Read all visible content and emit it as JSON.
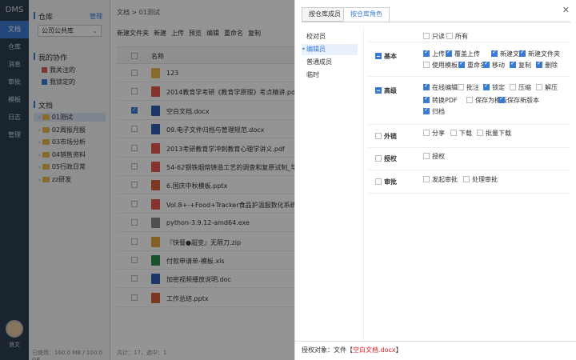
{
  "app": {
    "brand": "DMS",
    "user": "浪文"
  },
  "nav": [
    "文档",
    "仓库",
    "消息",
    "审批",
    "模板",
    "日志",
    "管理"
  ],
  "sidebar": {
    "repo_title": "仓库",
    "manage": "管理",
    "repo_select": "公司公共库",
    "collab_title": "我的协作",
    "collab": [
      "我关注的",
      "我锁定的"
    ],
    "docs_title": "文档",
    "tree": [
      "01测试",
      "02周报月报",
      "03市场分析",
      "04销售资料",
      "05行政日常",
      "zz研发"
    ],
    "footer": "已使用：160.0 MB / 100.0 GB"
  },
  "main": {
    "breadcrumb": "文档 > 01测试",
    "toolbar": [
      "新建文件夹",
      "新建",
      "上传",
      "预览",
      "编辑",
      "重命名",
      "复制"
    ],
    "col_name": "名称",
    "files": [
      {
        "name": "123",
        "type": "folder",
        "checked": false
      },
      {
        "name": "2014教育学考研《教育学原理》考点精讲.pdf",
        "type": "pdf",
        "checked": false
      },
      {
        "name": "空白文档.docx",
        "type": "doc",
        "checked": true
      },
      {
        "name": "09.电子文件归档与管理规范.docx",
        "type": "doc",
        "checked": false
      },
      {
        "name": "2013考研教育学冲刺教育心理学讲义.pdf",
        "type": "pdf",
        "checked": false
      },
      {
        "name": "54-62钢铁烟熔铸造工艺的调查和复原试制_华觉明.pdf",
        "type": "pdf",
        "checked": false
      },
      {
        "name": "6.国庆中秋模板.pptx",
        "type": "ppt",
        "checked": false
      },
      {
        "name": "Vol.8+-+Food+Tracker食品护温服数化系统.pdf",
        "type": "pdf",
        "checked": false
      },
      {
        "name": "python-3.9.12-amd64.exe",
        "type": "exe",
        "checked": false
      },
      {
        "name": "『快餐●超变』无限刀.zip",
        "type": "zip",
        "checked": false
      },
      {
        "name": "付款申请单-模板.xls",
        "type": "xls",
        "checked": false
      },
      {
        "name": "加密视频播放说明.doc",
        "type": "doc",
        "checked": false
      },
      {
        "name": "工作总结.pptx",
        "type": "ppt",
        "checked": false
      }
    ],
    "footer": "共计：17，选中：1"
  },
  "drawer": {
    "tabs": [
      "按仓库成员",
      "按仓库角色"
    ],
    "active_tab": 1,
    "roles": [
      "校对员",
      "编辑员",
      "普通成员",
      "临时"
    ],
    "active_role": 1,
    "top_opts": [
      {
        "label": "只读",
        "on": false
      },
      {
        "label": "所有",
        "on": false
      }
    ],
    "groups": [
      {
        "name": "基本",
        "ind": true,
        "opts": [
          {
            "label": "上传",
            "on": true
          },
          {
            "label": "覆盖上传",
            "on": true
          },
          {
            "label": "新建文件",
            "on": true
          },
          {
            "label": "新建文件夹",
            "on": true
          },
          {
            "label": "使用模板",
            "on": false
          },
          {
            "label": "重命名",
            "on": true
          },
          {
            "label": "移动",
            "on": true
          },
          {
            "label": "复制",
            "on": true
          },
          {
            "label": "删除",
            "on": true
          }
        ]
      },
      {
        "name": "高级",
        "ind": true,
        "opts": [
          {
            "label": "在线编辑",
            "on": true
          },
          {
            "label": "批注",
            "on": false
          },
          {
            "label": "锁定",
            "on": true
          },
          {
            "label": "压缩",
            "on": false
          },
          {
            "label": "解压",
            "on": false
          },
          {
            "label": "转换PDF",
            "on": true
          },
          {
            "label": "保存为模板",
            "on": false
          },
          {
            "label": "保存新版本",
            "on": true
          },
          {
            "label": "归档",
            "on": true
          }
        ]
      },
      {
        "name": "外链",
        "ind": false,
        "opts": [
          {
            "label": "分享",
            "on": false
          },
          {
            "label": "下载",
            "on": false
          },
          {
            "label": "批量下载",
            "on": false
          }
        ]
      },
      {
        "name": "授权",
        "ind": false,
        "opts": [
          {
            "label": "授权",
            "on": false
          }
        ]
      },
      {
        "name": "审批",
        "ind": false,
        "opts": [
          {
            "label": "发起审批",
            "on": false
          },
          {
            "label": "处理审批",
            "on": false
          }
        ]
      }
    ],
    "footer_label": "授权对象：",
    "footer_prefix": "文件【",
    "footer_target": "空白文档.docx",
    "footer_suffix": "】",
    "colors": {
      "accent": "#3a7bd5",
      "highlight": "#e02020"
    }
  }
}
